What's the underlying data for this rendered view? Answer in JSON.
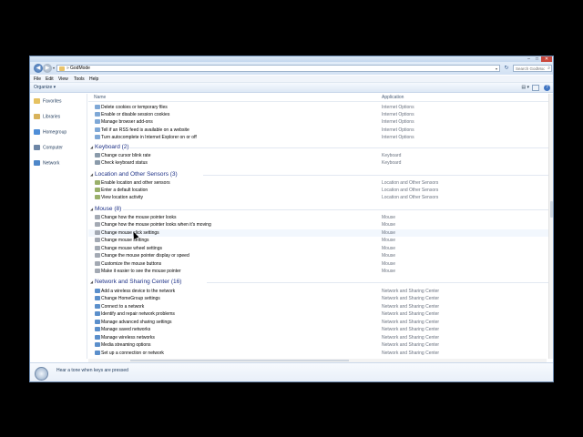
{
  "window": {
    "controls": {
      "minimize": "–",
      "maximize": "□",
      "close": "✕"
    }
  },
  "address": {
    "separator": "»",
    "path": "GodMode",
    "search_placeholder": "Search GodMode"
  },
  "menu": [
    "File",
    "Edit",
    "View",
    "Tools",
    "Help"
  ],
  "toolbar": {
    "organize": "Organize ▾"
  },
  "nav": [
    {
      "label": "Favorites",
      "color": "#e6c261"
    },
    {
      "label": "Libraries",
      "color": "#d8b25a"
    },
    {
      "label": "Homegroup",
      "color": "#4f8ed8"
    },
    {
      "label": "Computer",
      "color": "#6d86a6"
    },
    {
      "label": "Network",
      "color": "#4d87c9"
    }
  ],
  "columns": {
    "name": "Name",
    "application": "Application"
  },
  "groups": {
    "internet_options": {
      "items": [
        {
          "name": "Delete cookies or temporary files",
          "app": "Internet Options"
        },
        {
          "name": "Enable or disable session cookies",
          "app": "Internet Options"
        },
        {
          "name": "Manage browser add-ons",
          "app": "Internet Options"
        },
        {
          "name": "Tell if an RSS feed is available on a website",
          "app": "Internet Options"
        },
        {
          "name": "Turn autocomplete in Internet Explorer on or off",
          "app": "Internet Options"
        }
      ]
    },
    "keyboard": {
      "title": "Keyboard (2)",
      "items": [
        {
          "name": "Change cursor blink rate",
          "app": "Keyboard"
        },
        {
          "name": "Check keyboard status",
          "app": "Keyboard"
        }
      ]
    },
    "location": {
      "title": "Location and Other Sensors (3)",
      "items": [
        {
          "name": "Enable location and other sensors",
          "app": "Location and Other Sensors"
        },
        {
          "name": "Enter a default location",
          "app": "Location and Other Sensors"
        },
        {
          "name": "View location activity",
          "app": "Location and Other Sensors"
        }
      ]
    },
    "mouse": {
      "title": "Mouse (8)",
      "items": [
        {
          "name": "Change how the mouse pointer looks",
          "app": "Mouse"
        },
        {
          "name": "Change how the mouse pointer looks when it's moving",
          "app": "Mouse"
        },
        {
          "name": "Change mouse click settings",
          "app": "Mouse"
        },
        {
          "name": "Change mouse settings",
          "app": "Mouse"
        },
        {
          "name": "Change mouse wheel settings",
          "app": "Mouse"
        },
        {
          "name": "Change the mouse pointer display or speed",
          "app": "Mouse"
        },
        {
          "name": "Customize the mouse buttons",
          "app": "Mouse"
        },
        {
          "name": "Make it easier to see the mouse pointer",
          "app": "Mouse"
        }
      ]
    },
    "network": {
      "title": "Network and Sharing Center (16)",
      "items": [
        {
          "name": "Add a wireless device to the network",
          "app": "Network and Sharing Center"
        },
        {
          "name": "Change HomeGroup settings",
          "app": "Network and Sharing Center"
        },
        {
          "name": "Connect to a network",
          "app": "Network and Sharing Center"
        },
        {
          "name": "Identify and repair network problems",
          "app": "Network and Sharing Center"
        },
        {
          "name": "Manage advanced sharing settings",
          "app": "Network and Sharing Center"
        },
        {
          "name": "Manage saved networks",
          "app": "Network and Sharing Center"
        },
        {
          "name": "Manage wireless networks",
          "app": "Network and Sharing Center"
        },
        {
          "name": "Media streaming options",
          "app": "Network and Sharing Center"
        },
        {
          "name": "Set up a connection or network",
          "app": "Network and Sharing Center"
        }
      ]
    }
  },
  "details": {
    "text": "Hear a tone when keys are pressed"
  },
  "colors": {
    "group_title": "#1e3287",
    "selection": "#f2f7fd"
  }
}
